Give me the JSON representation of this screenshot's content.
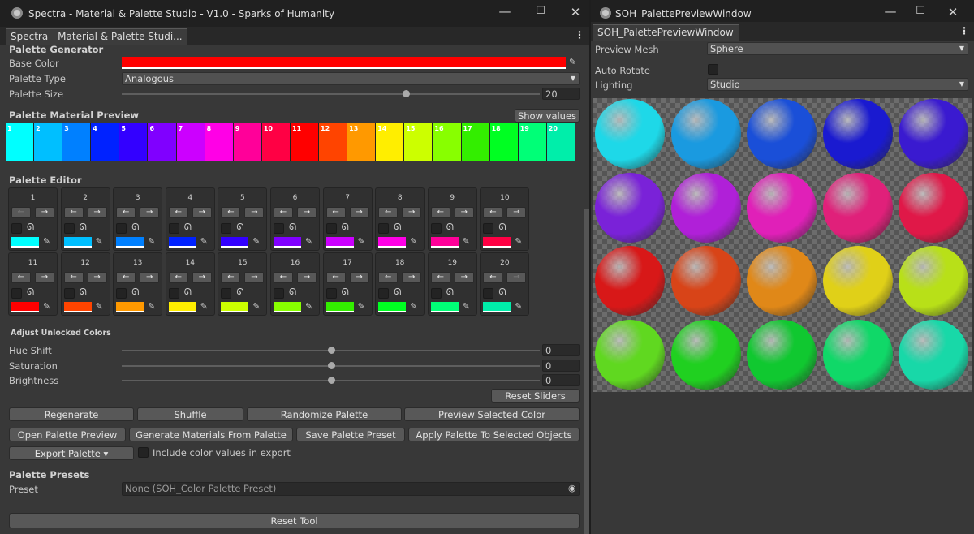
{
  "left": {
    "title": "Spectra - Material & Palette Studio -  V1.0 - Sparks of Humanity",
    "tab": "Spectra - Material & Palette Studi...",
    "section_generator": "Palette Generator",
    "base_color_label": "Base Color",
    "base_color": "#ff0000",
    "palette_type_label": "Palette Type",
    "palette_type_value": "Analogous",
    "palette_size_label": "Palette Size",
    "palette_size_value": "20",
    "palette_size_fraction": 0.68,
    "material_preview_label": "Palette Material Preview",
    "show_values_button": "Show values",
    "swatches": [
      {
        "n": "1",
        "c": "#00ffff"
      },
      {
        "n": "2",
        "c": "#00bfff"
      },
      {
        "n": "3",
        "c": "#0080ff"
      },
      {
        "n": "4",
        "c": "#0022ff"
      },
      {
        "n": "5",
        "c": "#3300ff"
      },
      {
        "n": "6",
        "c": "#8000ff"
      },
      {
        "n": "7",
        "c": "#cc00ff"
      },
      {
        "n": "8",
        "c": "#ff00e6"
      },
      {
        "n": "9",
        "c": "#ff0099"
      },
      {
        "n": "10",
        "c": "#ff0044"
      },
      {
        "n": "11",
        "c": "#ff0000"
      },
      {
        "n": "12",
        "c": "#ff4400"
      },
      {
        "n": "13",
        "c": "#ff9900"
      },
      {
        "n": "14",
        "c": "#ffee00"
      },
      {
        "n": "15",
        "c": "#ccff00"
      },
      {
        "n": "16",
        "c": "#88ff00"
      },
      {
        "n": "17",
        "c": "#33ee00"
      },
      {
        "n": "18",
        "c": "#00ff22"
      },
      {
        "n": "19",
        "c": "#00ff77"
      },
      {
        "n": "20",
        "c": "#00eeaa"
      }
    ],
    "palette_editor_label": "Palette Editor",
    "adjust_label": "Adjust Unlocked Colors",
    "hue_shift_label": "Hue Shift",
    "hue_shift_value": "0",
    "saturation_label": "Saturation",
    "saturation_value": "0",
    "brightness_label": "Brightness",
    "brightness_value": "0",
    "adjust_slider_fraction": 0.5,
    "reset_sliders": "Reset Sliders",
    "buttons_row1": [
      "Regenerate",
      "Shuffle",
      "Randomize Palette",
      "Preview Selected Color"
    ],
    "buttons_row2": [
      "Open Palette Preview",
      "Generate Materials From Palette",
      "Save Palette Preset",
      "Apply Palette To Selected Objects"
    ],
    "export_button": "Export Palette ▾",
    "include_values_label": "Include color values in export",
    "presets_label": "Palette Presets",
    "preset_label": "Preset",
    "preset_value": "None (SOH_Color Palette Preset)",
    "reset_tool": "Reset Tool"
  },
  "right": {
    "title": "SOH_PalettePreviewWindow",
    "tab": "SOH_PalettePreviewWindow",
    "preview_mesh_label": "Preview Mesh",
    "preview_mesh_value": "Sphere",
    "auto_rotate_label": "Auto Rotate",
    "lighting_label": "Lighting",
    "lighting_value": "Studio",
    "spheres": [
      "#1ed8e8",
      "#1a9ae0",
      "#1a4fd8",
      "#1a1ad0",
      "#3a1ad0",
      "#7a22d8",
      "#b020d8",
      "#e020b8",
      "#e0207a",
      "#e01848",
      "#d81818",
      "#d84418",
      "#e08818",
      "#e0d018",
      "#b8e018",
      "#60d820",
      "#20d020",
      "#10c830",
      "#10d868",
      "#18d8a8"
    ]
  }
}
